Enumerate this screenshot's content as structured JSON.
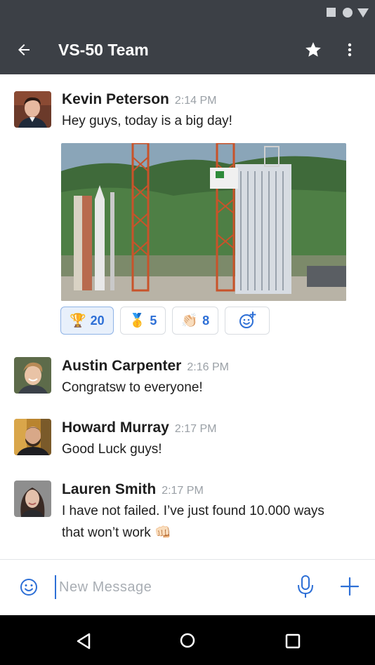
{
  "header": {
    "title": "VS-50 Team",
    "back_icon": "arrow-left-icon",
    "star_icon": "star-icon",
    "more_icon": "more-vertical-icon",
    "background": "#3c4046"
  },
  "messages": [
    {
      "author": "Kevin Peterson",
      "time": "2:14 PM",
      "text": "Hey guys, today is a big day!",
      "has_image": true
    },
    {
      "author": "Austin Carpenter",
      "time": "2:16 PM",
      "text": "Congratsw to everyone!"
    },
    {
      "author": "Howard Murray",
      "time": "2:17 PM",
      "text": "Good Luck guys!"
    },
    {
      "author": "Lauren Smith",
      "time": "2:17 PM",
      "text": "I have not failed. I’ve just found 10.000 ways that won’t work 👊🏻"
    }
  ],
  "reactions": [
    {
      "emoji": "🏆",
      "count": "20",
      "active": true
    },
    {
      "emoji": "🥇",
      "count": "5",
      "active": false
    },
    {
      "emoji": "👏🏻",
      "count": "8",
      "active": false
    }
  ],
  "composer": {
    "placeholder": "New Message",
    "accent": "#2d6fd6"
  }
}
